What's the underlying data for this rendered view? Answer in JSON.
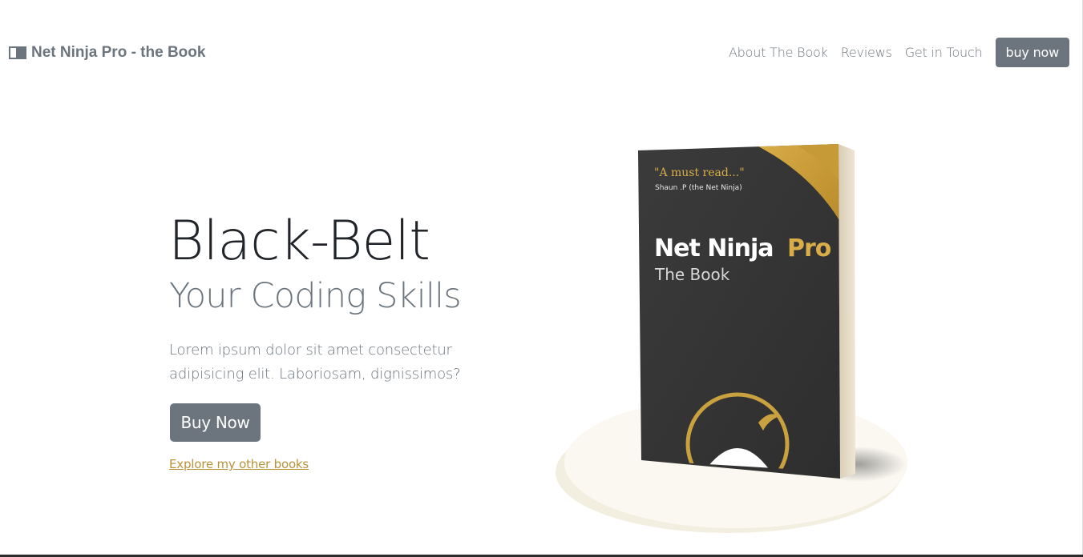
{
  "navbar": {
    "brand": "Net Ninja Pro - the Book",
    "brand_icon": "book-open-icon",
    "links": [
      "About The Book",
      "Reviews",
      "Get in Touch"
    ],
    "cta": "buy now"
  },
  "hero": {
    "title": "Black-Belt",
    "subtitle": "Your Coding Skills",
    "text": "Lorem ipsum dolor sit amet consectetur adipisicing elit. Laboriosam, dignissimos?",
    "button": "Buy Now",
    "link": "Explore my other books"
  },
  "book": {
    "quote": "\"A must read...\"",
    "quote_author": "Shaun .P (the Net Ninja)",
    "title_main": "Net Ninja",
    "title_accent": "Pro",
    "title_sub": "The Book"
  },
  "colors": {
    "secondary": "#6c757d",
    "accent": "#b8933a",
    "cover": "#3a3a3a",
    "platform": "#f7f4e8"
  }
}
